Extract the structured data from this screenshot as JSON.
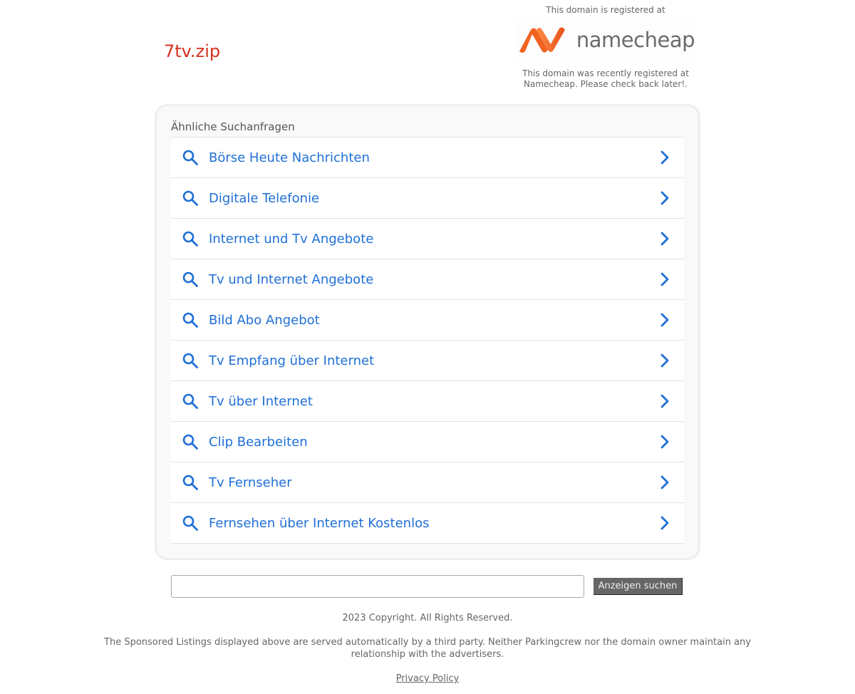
{
  "domain": "7tv.zip",
  "registrar": {
    "top_text": "This domain is registered at",
    "logo_text": "namecheap",
    "bottom_text": "This domain was recently registered at Namecheap. Please check back later!."
  },
  "related": {
    "heading": "Ähnliche Suchanfragen",
    "items": [
      {
        "label": "Börse Heute Nachrichten"
      },
      {
        "label": "Digitale Telefonie"
      },
      {
        "label": "Internet und Tv Angebote"
      },
      {
        "label": "Tv und Internet Angebote"
      },
      {
        "label": "Bild Abo Angebot"
      },
      {
        "label": "Tv Empfang über Internet"
      },
      {
        "label": "Tv über Internet"
      },
      {
        "label": "Clip Bearbeiten"
      },
      {
        "label": "Tv Fernseher"
      },
      {
        "label": "Fernsehen über Internet Kostenlos"
      }
    ]
  },
  "search": {
    "value": "",
    "button_label": "Anzeigen suchen"
  },
  "footer": {
    "copyright": "2023 Copyright. All Rights Reserved.",
    "disclaimer": "The Sponsored Listings displayed above are served automatically by a third party. Neither Parkingcrew nor the domain owner maintain any relationship with the advertisers.",
    "privacy": "Privacy Policy"
  },
  "colors": {
    "domain": "#d6321f",
    "link": "#1f6fd6",
    "logo_orange": "#f26322"
  }
}
